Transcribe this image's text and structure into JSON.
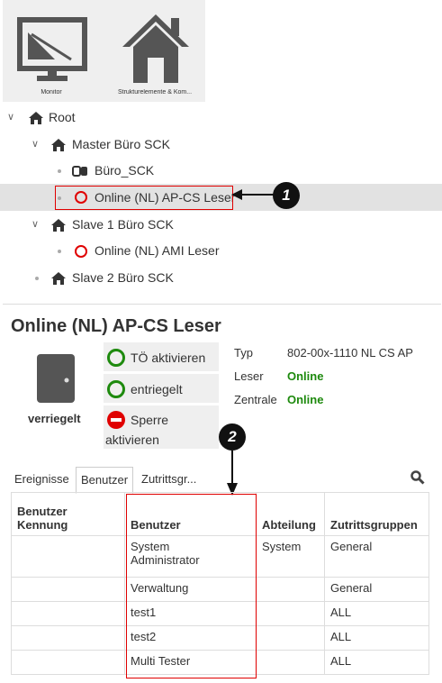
{
  "toolbar": {
    "monitor_label": "Monitor",
    "structure_label": "Strukturelemente & Kom..."
  },
  "tree": {
    "root": "Root",
    "master": "Master Büro SCK",
    "office": "Büro_SCK",
    "reader_selected": "Online (NL) AP-CS Leser",
    "slave1": "Slave 1 Büro SCK",
    "reader_ami": "Online (NL) AMI Leser",
    "slave2": "Slave 2 Büro SCK"
  },
  "callouts": {
    "one": "1",
    "two": "2"
  },
  "detail": {
    "title": "Online (NL) AP-CS Leser",
    "door_state": "verriegelt",
    "actions": {
      "to_activate": "TÖ aktivieren",
      "unlocked": "entriegelt",
      "block_line1": "Sperre",
      "block_line2": "aktivieren"
    },
    "info": {
      "typ_label": "Typ",
      "typ_value": "802-00x-1110 NL CS AP",
      "leser_label": "Leser",
      "leser_value": "Online",
      "zentrale_label": "Zentrale",
      "zentrale_value": "Online"
    }
  },
  "tabs": [
    "Ereignisse",
    "Benutzer",
    "Zutrittsgr..."
  ],
  "table": {
    "headers": {
      "kennung_line1": "Benutzer",
      "kennung_line2": "Kennung",
      "benutzer": "Benutzer",
      "abteilung": "Abteilung",
      "gruppen": "Zutrittsgruppen"
    },
    "rows": [
      {
        "kennung": "",
        "benutzer_line1": "System",
        "benutzer_line2": "Administrator",
        "abteilung": "System",
        "gruppen": "General"
      },
      {
        "kennung": "",
        "benutzer_line1": "Verwaltung",
        "benutzer_line2": "",
        "abteilung": "",
        "gruppen": "General"
      },
      {
        "kennung": "",
        "benutzer_line1": "test1",
        "benutzer_line2": "",
        "abteilung": "",
        "gruppen": "ALL"
      },
      {
        "kennung": "",
        "benutzer_line1": "test2",
        "benutzer_line2": "",
        "abteilung": "",
        "gruppen": "ALL"
      },
      {
        "kennung": "",
        "benutzer_line1": "Multi Tester",
        "benutzer_line2": "",
        "abteilung": "",
        "gruppen": "ALL"
      }
    ]
  },
  "colors": {
    "accent_red": "#e00000",
    "status_green": "#1e8a0e",
    "selection": "#e2e2e2"
  },
  "icons": [
    "monitor-icon",
    "house-icon",
    "chevron-down-icon",
    "door-icon",
    "reader-ring-icon",
    "green-ring-icon",
    "no-entry-icon",
    "search-icon",
    "arrow-icon"
  ]
}
